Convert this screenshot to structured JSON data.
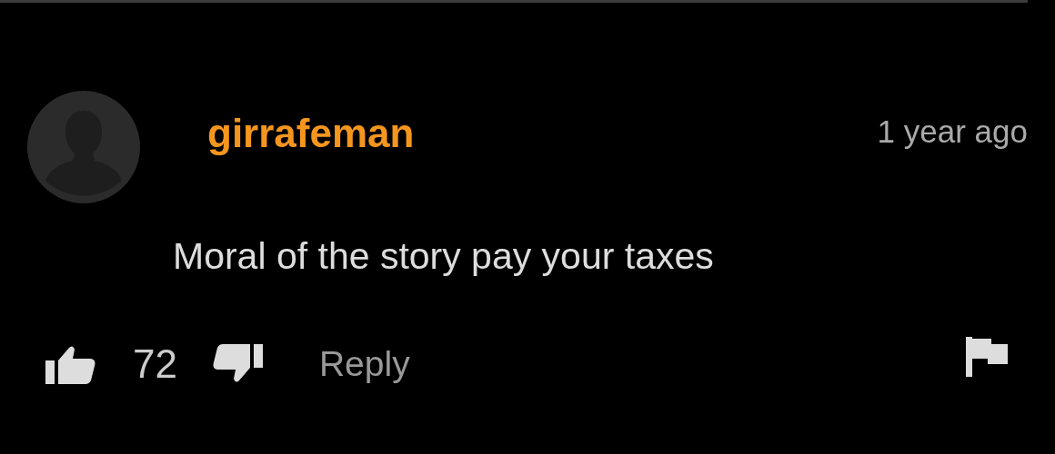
{
  "comment": {
    "author": "girrafeman",
    "time": "1 year ago",
    "text": "Moral of the story pay your taxes",
    "likes": "72",
    "reply": "Reply"
  }
}
